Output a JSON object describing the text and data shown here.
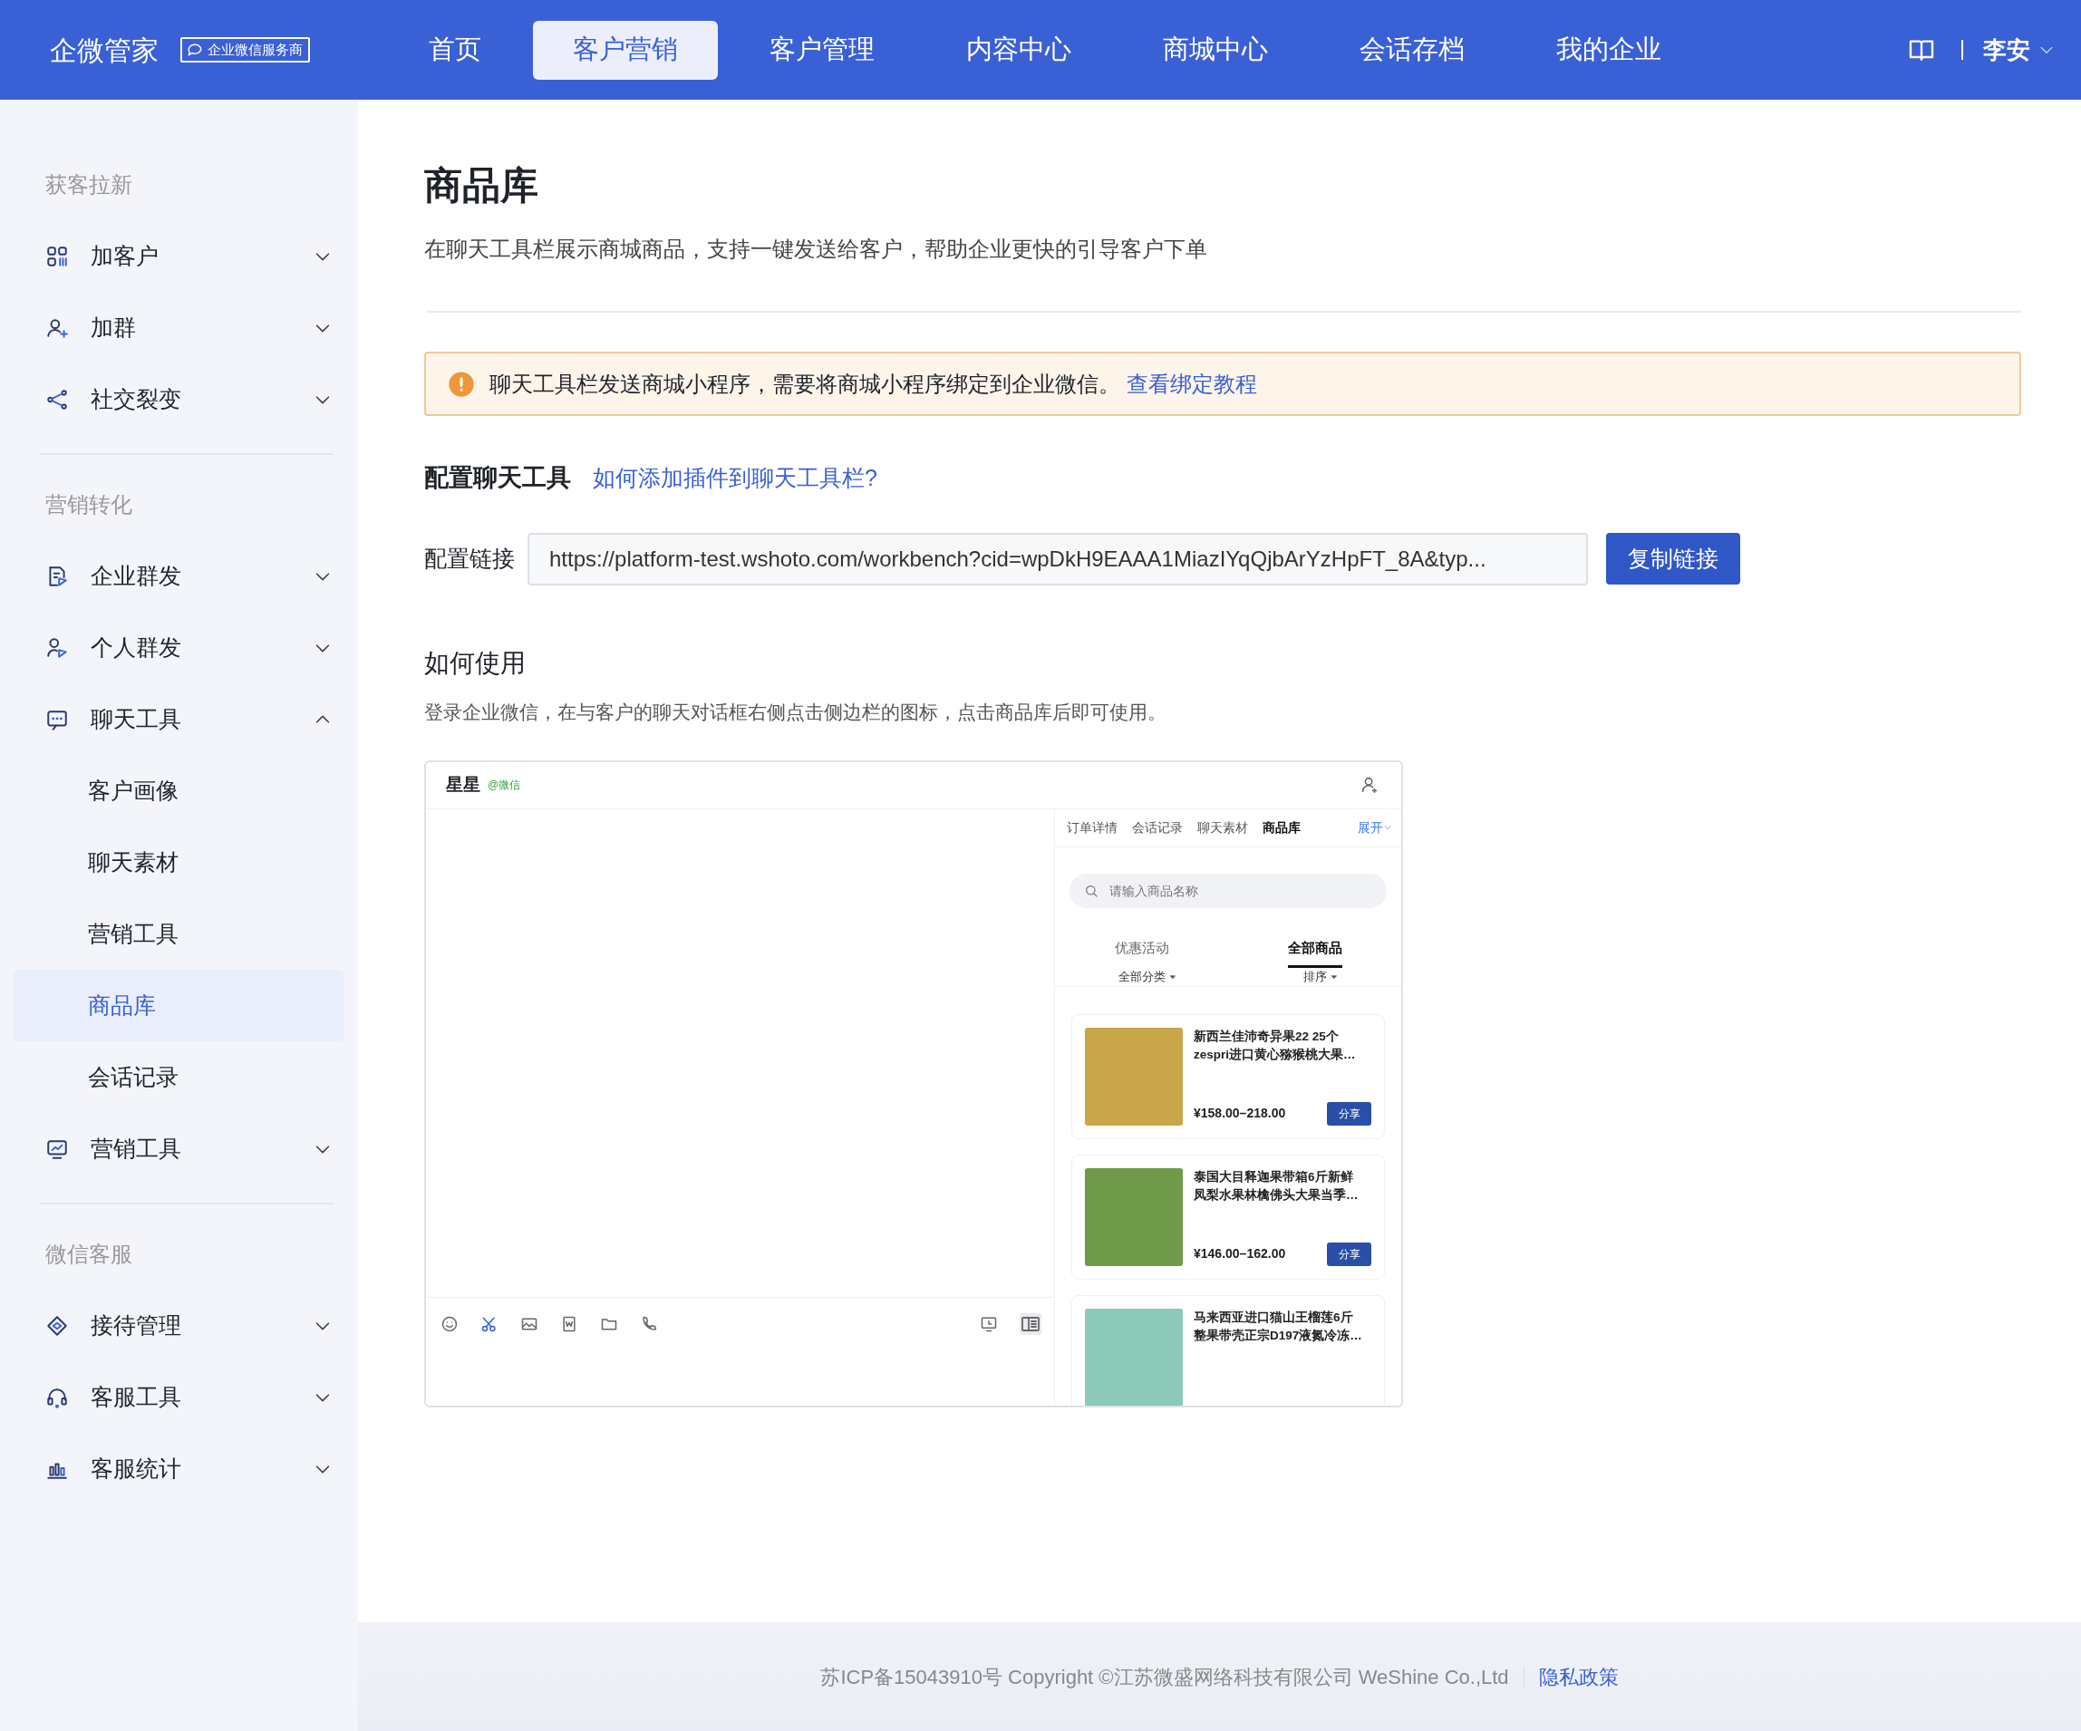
{
  "header": {
    "brand": "企微管家",
    "badge": "企业微信服务商",
    "nav": [
      {
        "label": "首页",
        "selected": false
      },
      {
        "label": "客户营销",
        "selected": true
      },
      {
        "label": "客户管理",
        "selected": false
      },
      {
        "label": "内容中心",
        "selected": false
      },
      {
        "label": "商城中心",
        "selected": false
      },
      {
        "label": "会话存档",
        "selected": false
      },
      {
        "label": "我的企业",
        "selected": false
      }
    ],
    "user": "李安"
  },
  "sidebar": {
    "sections": [
      {
        "title": "获客拉新",
        "items": [
          {
            "label": "加客户",
            "expanded": false
          },
          {
            "label": "加群",
            "expanded": false
          },
          {
            "label": "社交裂变",
            "expanded": false
          }
        ]
      },
      {
        "title": "营销转化",
        "items": [
          {
            "label": "企业群发",
            "expanded": false
          },
          {
            "label": "个人群发",
            "expanded": false
          },
          {
            "label": "聊天工具",
            "expanded": true,
            "children": [
              {
                "label": "客户画像",
                "selected": false
              },
              {
                "label": "聊天素材",
                "selected": false
              },
              {
                "label": "营销工具",
                "selected": false
              },
              {
                "label": "商品库",
                "selected": true
              },
              {
                "label": "会话记录",
                "selected": false
              }
            ]
          },
          {
            "label": "营销工具",
            "expanded": false
          }
        ]
      },
      {
        "title": "微信客服",
        "items": [
          {
            "label": "接待管理",
            "expanded": false
          },
          {
            "label": "客服工具",
            "expanded": false
          },
          {
            "label": "客服统计",
            "expanded": false
          }
        ]
      }
    ]
  },
  "page": {
    "title": "商品库",
    "subtitle": "在聊天工具栏展示商城商品，支持一键发送给客户，帮助企业更快的引导客户下单",
    "alert": {
      "text": "聊天工具栏发送商城小程序，需要将商城小程序绑定到企业微信。",
      "link": "查看绑定教程"
    },
    "config": {
      "heading": "配置聊天工具",
      "help_link": "如何添加插件到聊天工具栏?",
      "label": "配置链接",
      "value": "https://platform-test.wshoto.com/workbench?cid=wpDkH9EAAA1MiazIYqQjbArYzHpFT_8A&typ...",
      "button": "复制链接"
    },
    "usage": {
      "heading": "如何使用",
      "text": "登录企业微信，在与客户的聊天对话框右侧点击侧边栏的图标，点击商品库后即可使用。"
    },
    "preview": {
      "contact": "星星",
      "source": "@微信",
      "tabs": [
        {
          "label": "订单详情",
          "selected": false
        },
        {
          "label": "会话记录",
          "selected": false
        },
        {
          "label": "聊天素材",
          "selected": false
        },
        {
          "label": "商品库",
          "selected": true
        }
      ],
      "expand": "展开",
      "search_placeholder": "请输入商品名称",
      "segments": [
        {
          "label": "优惠活动",
          "selected": false
        },
        {
          "label": "全部商品",
          "selected": true
        }
      ],
      "filters": [
        "全部分类",
        "排序"
      ],
      "products": [
        {
          "title_lines": [
            "新西兰佳沛奇异果22 25个",
            "zespri进口黄心猕猴桃大果…"
          ],
          "price": "¥158.00–218.00",
          "share": "分享"
        },
        {
          "title_lines": [
            "泰国大目释迦果带箱6斤新鲜",
            "凤梨水果林檎佛头大果当季…"
          ],
          "price": "¥146.00–162.00",
          "share": "分享"
        },
        {
          "title_lines": [
            "马来西亚进口猫山王榴莲6斤",
            "整果带壳正宗D197液氮冷冻…"
          ]
        }
      ]
    }
  },
  "footer": {
    "text": "苏ICP备15043910号 Copyright ©江苏微盛网络科技有限公司 WeShine Co.,Ltd",
    "link": "隐私政策"
  }
}
